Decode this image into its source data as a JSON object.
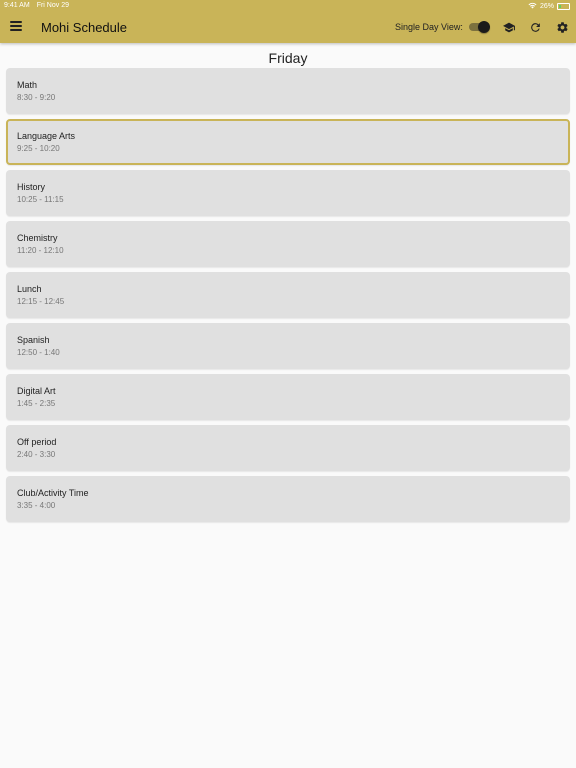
{
  "status_bar": {
    "time": "9:41 AM",
    "date": "Fri Nov 29",
    "battery": "26%",
    "battery_level": 0.26
  },
  "app_bar": {
    "title": "Mohi Schedule",
    "single_day_label": "Single Day View:",
    "single_day_enabled": true,
    "background_color": "#c9b458"
  },
  "day": {
    "name": "Friday"
  },
  "schedule": [
    {
      "name": "Math",
      "time": "8:30 - 9:20",
      "current": false
    },
    {
      "name": "Language Arts",
      "time": "9:25 - 10:20",
      "current": true
    },
    {
      "name": "History",
      "time": "10:25 - 11:15",
      "current": false
    },
    {
      "name": "Chemistry",
      "time": "11:20 - 12:10",
      "current": false
    },
    {
      "name": "Lunch",
      "time": "12:15 - 12:45",
      "current": false
    },
    {
      "name": "Spanish",
      "time": "12:50 - 1:40",
      "current": false
    },
    {
      "name": "Digital Art",
      "time": "1:45 - 2:35",
      "current": false
    },
    {
      "name": "Off period",
      "time": "2:40 - 3:30",
      "current": false
    },
    {
      "name": "Club/Activity Time",
      "time": "3:35 - 4:00",
      "current": false
    }
  ],
  "icons": {
    "menu": "hamburger-menu-icon",
    "classes": "graduation-cap-icon",
    "refresh": "refresh-icon",
    "settings": "gear-icon"
  }
}
